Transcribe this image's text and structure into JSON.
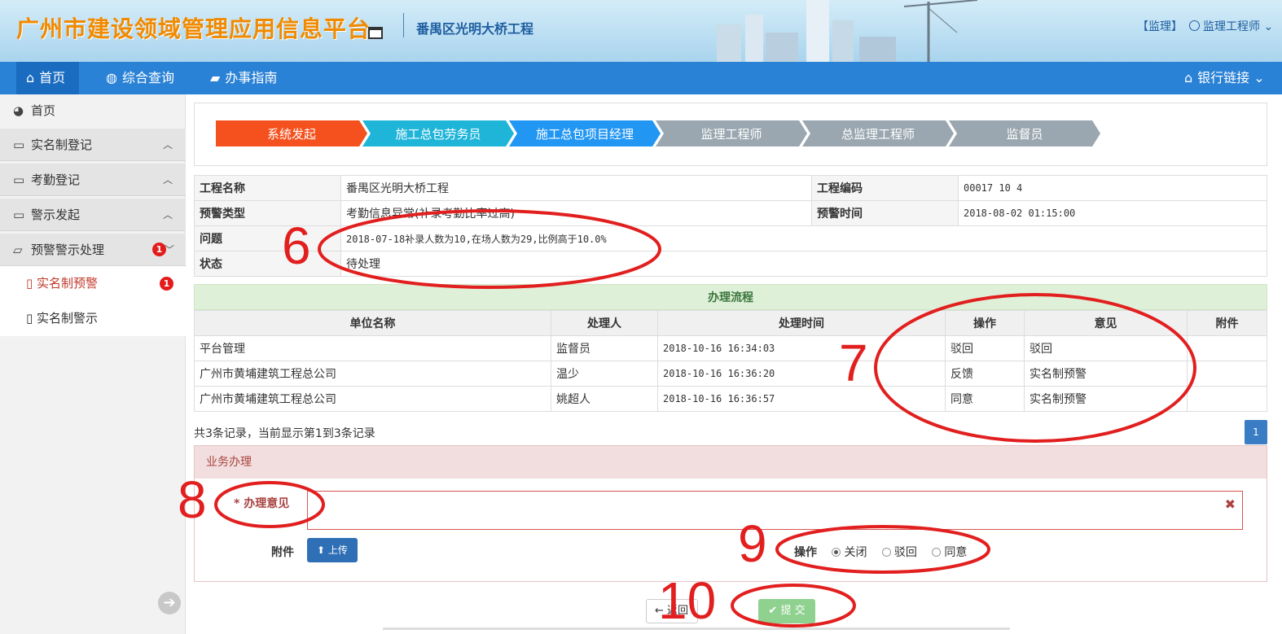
{
  "header": {
    "app_title": "广州市建设领域管理应用信息平台",
    "project": "番禺区光明大桥工程",
    "role": "【监理】",
    "user": "监理工程师"
  },
  "nav": {
    "items": [
      {
        "label": "首页",
        "icon": "home-icon"
      },
      {
        "label": "综合查询",
        "icon": "globe-icon"
      },
      {
        "label": "办事指南",
        "icon": "book-icon"
      }
    ],
    "bank_link": "银行链接"
  },
  "sidebar": {
    "home": "首页",
    "groups": [
      {
        "label": "实名制登记"
      },
      {
        "label": "考勤登记"
      },
      {
        "label": "警示发起"
      },
      {
        "label": "预警警示处理",
        "badge": "1"
      }
    ],
    "subitems": [
      {
        "label": "实名制预警",
        "badge": "1"
      },
      {
        "label": "实名制警示"
      }
    ]
  },
  "steps": [
    "系统发起",
    "施工总包劳务员",
    "施工总包项目经理",
    "监理工程师",
    "总监理工程师",
    "监督员"
  ],
  "colors": {
    "step_done": "#f4511e",
    "step_current": "#1fb5d9",
    "step_current2": "#2196f3",
    "step_pending": "#9aa7b0",
    "annotation": "#e21f1f",
    "nav": "#2a82d6"
  },
  "info": {
    "project_name_label": "工程名称",
    "project_name": "番禺区光明大桥工程",
    "project_code_label": "工程编码",
    "project_code": "00017  10  4",
    "warn_type_label": "预警类型",
    "warn_type": "考勤信息异常(补录考勤比率过高)",
    "warn_time_label": "预警时间",
    "warn_time": "2018-08-02 01:15:00",
    "issue_label": "问题",
    "issue": "2018-07-18补录人数为10,在场人数为29,比例高于10.0%",
    "status_label": "状态",
    "status": "待处理"
  },
  "flow": {
    "title": "办理流程",
    "headers": [
      "单位名称",
      "处理人",
      "处理时间",
      "操作",
      "意见",
      "附件"
    ],
    "rows": [
      [
        "平台管理",
        "监督员",
        "2018-10-16 16:34:03",
        "驳回",
        "驳回",
        ""
      ],
      [
        "广州市黄埔建筑工程总公司",
        "温少",
        "2018-10-16 16:36:20",
        "反馈",
        "实名制预警",
        ""
      ],
      [
        "广州市黄埔建筑工程总公司",
        "姚超人",
        "2018-10-16 16:36:57",
        "同意",
        "实名制预警",
        ""
      ]
    ]
  },
  "paging": {
    "summary": "共3条记录，当前显示第1到3条记录",
    "page": "1"
  },
  "biz": {
    "title": "业务办理",
    "opinion_label": "* 办理意见",
    "opinion_value": "",
    "attach_label": "附件",
    "upload_label": "上传",
    "ops_label": "操作",
    "options": [
      "关闭",
      "驳回",
      "同意"
    ],
    "selected": "关闭"
  },
  "actions": {
    "back": "返回",
    "submit": "提 交"
  },
  "annotations": [
    "6",
    "7",
    "8",
    "9",
    "10"
  ]
}
